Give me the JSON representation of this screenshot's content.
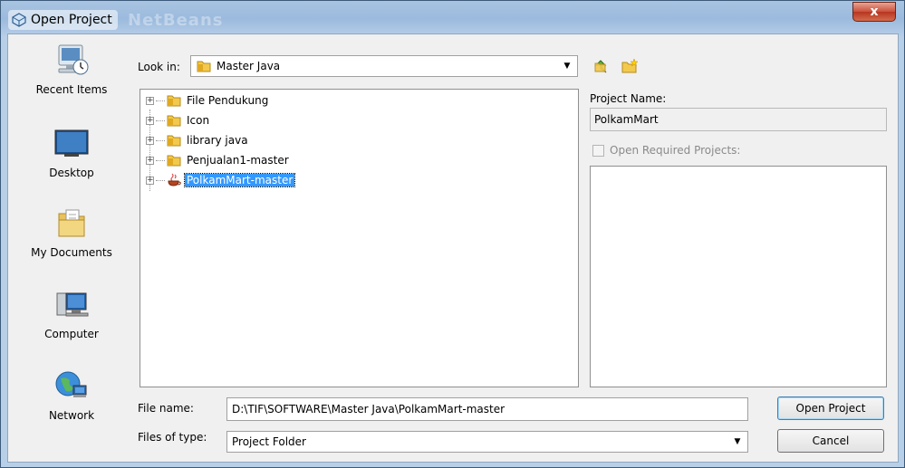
{
  "window": {
    "title": "Open Project",
    "background_title": "NetBeans",
    "close_symbol": "x"
  },
  "places": [
    {
      "label": "Recent Items",
      "icon": "recent-items-icon"
    },
    {
      "label": "Desktop",
      "icon": "desktop-icon"
    },
    {
      "label": "My Documents",
      "icon": "my-documents-icon"
    },
    {
      "label": "Computer",
      "icon": "computer-icon"
    },
    {
      "label": "Network",
      "icon": "network-icon"
    }
  ],
  "look_in": {
    "label": "Look in:",
    "value": "Master Java"
  },
  "file_list": [
    {
      "name": "File Pendukung",
      "type": "folder"
    },
    {
      "name": "Icon",
      "type": "folder"
    },
    {
      "name": "library java",
      "type": "folder"
    },
    {
      "name": "Penjualan1-master",
      "type": "folder"
    },
    {
      "name": "PolkamMart-master",
      "type": "project",
      "selected": true
    }
  ],
  "project_panel": {
    "name_label": "Project Name:",
    "name_value": "PolkamMart",
    "required_label": "Open Required Projects:"
  },
  "file_name": {
    "label": "File name:",
    "value": "D:\\TIF\\SOFTWARE\\Master Java\\PolkamMart-master"
  },
  "file_type": {
    "label": "Files of type:",
    "value": "Project Folder"
  },
  "buttons": {
    "open": "Open Project",
    "cancel": "Cancel"
  },
  "colors": {
    "selection": "#3399ff",
    "folder": "#f2c94c",
    "title_bar": "#9bbadd"
  }
}
